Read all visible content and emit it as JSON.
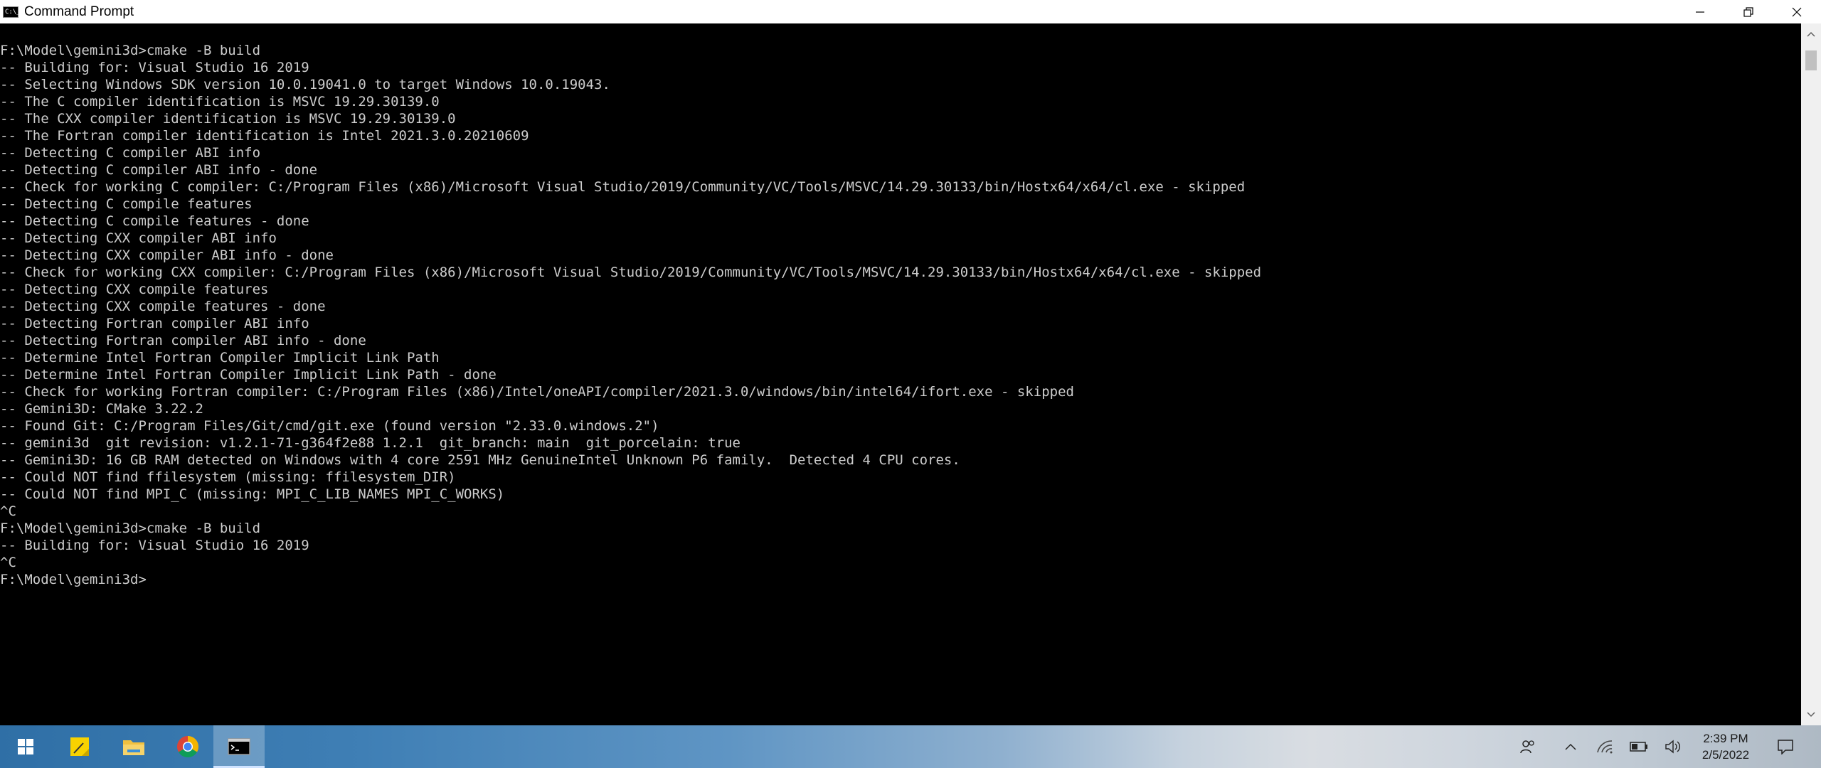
{
  "window": {
    "title": "Command Prompt",
    "icon_label": "C:\\_"
  },
  "console": {
    "lines": [
      "F:\\Model\\gemini3d>cmake -B build",
      "-- Building for: Visual Studio 16 2019",
      "-- Selecting Windows SDK version 10.0.19041.0 to target Windows 10.0.19043.",
      "-- The C compiler identification is MSVC 19.29.30139.0",
      "-- The CXX compiler identification is MSVC 19.29.30139.0",
      "-- The Fortran compiler identification is Intel 2021.3.0.20210609",
      "-- Detecting C compiler ABI info",
      "-- Detecting C compiler ABI info - done",
      "-- Check for working C compiler: C:/Program Files (x86)/Microsoft Visual Studio/2019/Community/VC/Tools/MSVC/14.29.30133/bin/Hostx64/x64/cl.exe - skipped",
      "-- Detecting C compile features",
      "-- Detecting C compile features - done",
      "-- Detecting CXX compiler ABI info",
      "-- Detecting CXX compiler ABI info - done",
      "-- Check for working CXX compiler: C:/Program Files (x86)/Microsoft Visual Studio/2019/Community/VC/Tools/MSVC/14.29.30133/bin/Hostx64/x64/cl.exe - skipped",
      "-- Detecting CXX compile features",
      "-- Detecting CXX compile features - done",
      "-- Detecting Fortran compiler ABI info",
      "-- Detecting Fortran compiler ABI info - done",
      "-- Determine Intel Fortran Compiler Implicit Link Path",
      "-- Determine Intel Fortran Compiler Implicit Link Path - done",
      "-- Check for working Fortran compiler: C:/Program Files (x86)/Intel/oneAPI/compiler/2021.3.0/windows/bin/intel64/ifort.exe - skipped",
      "-- Gemini3D: CMake 3.22.2",
      "-- Found Git: C:/Program Files/Git/cmd/git.exe (found version \"2.33.0.windows.2\")",
      "-- gemini3d  git revision: v1.2.1-71-g364f2e88 1.2.1  git_branch: main  git_porcelain: true",
      "-- Gemini3D: 16 GB RAM detected on Windows with 4 core 2591 MHz GenuineIntel Unknown P6 family.  Detected 4 CPU cores.",
      "-- Could NOT find ffilesystem (missing: ffilesystem_DIR)",
      "-- Could NOT find MPI_C (missing: MPI_C_LIB_NAMES MPI_C_WORKS)",
      "^C",
      "F:\\Model\\gemini3d>cmake -B build",
      "-- Building for: Visual Studio 16 2019",
      "^C",
      "F:\\Model\\gemini3d>"
    ]
  },
  "taskbar": {
    "apps": [
      {
        "name": "start-button",
        "icon": "windows-logo-icon"
      },
      {
        "name": "sticky-notes",
        "icon": "sticky-notes-icon"
      },
      {
        "name": "file-explorer",
        "icon": "folder-icon"
      },
      {
        "name": "chrome",
        "icon": "chrome-icon"
      },
      {
        "name": "command-prompt",
        "icon": "terminal-icon",
        "active": true
      }
    ],
    "clock": {
      "time": "2:39 PM",
      "date": "2/5/2022"
    }
  },
  "colors": {
    "console_text": "#cccccc",
    "console_bg": "#000000",
    "sticky_yellow": "#f8d200",
    "folder_yellow": "#f0c040",
    "chrome_red": "#db4437",
    "chrome_green": "#0f9d58",
    "chrome_yellow": "#f4b400",
    "chrome_blue": "#4285f4"
  }
}
